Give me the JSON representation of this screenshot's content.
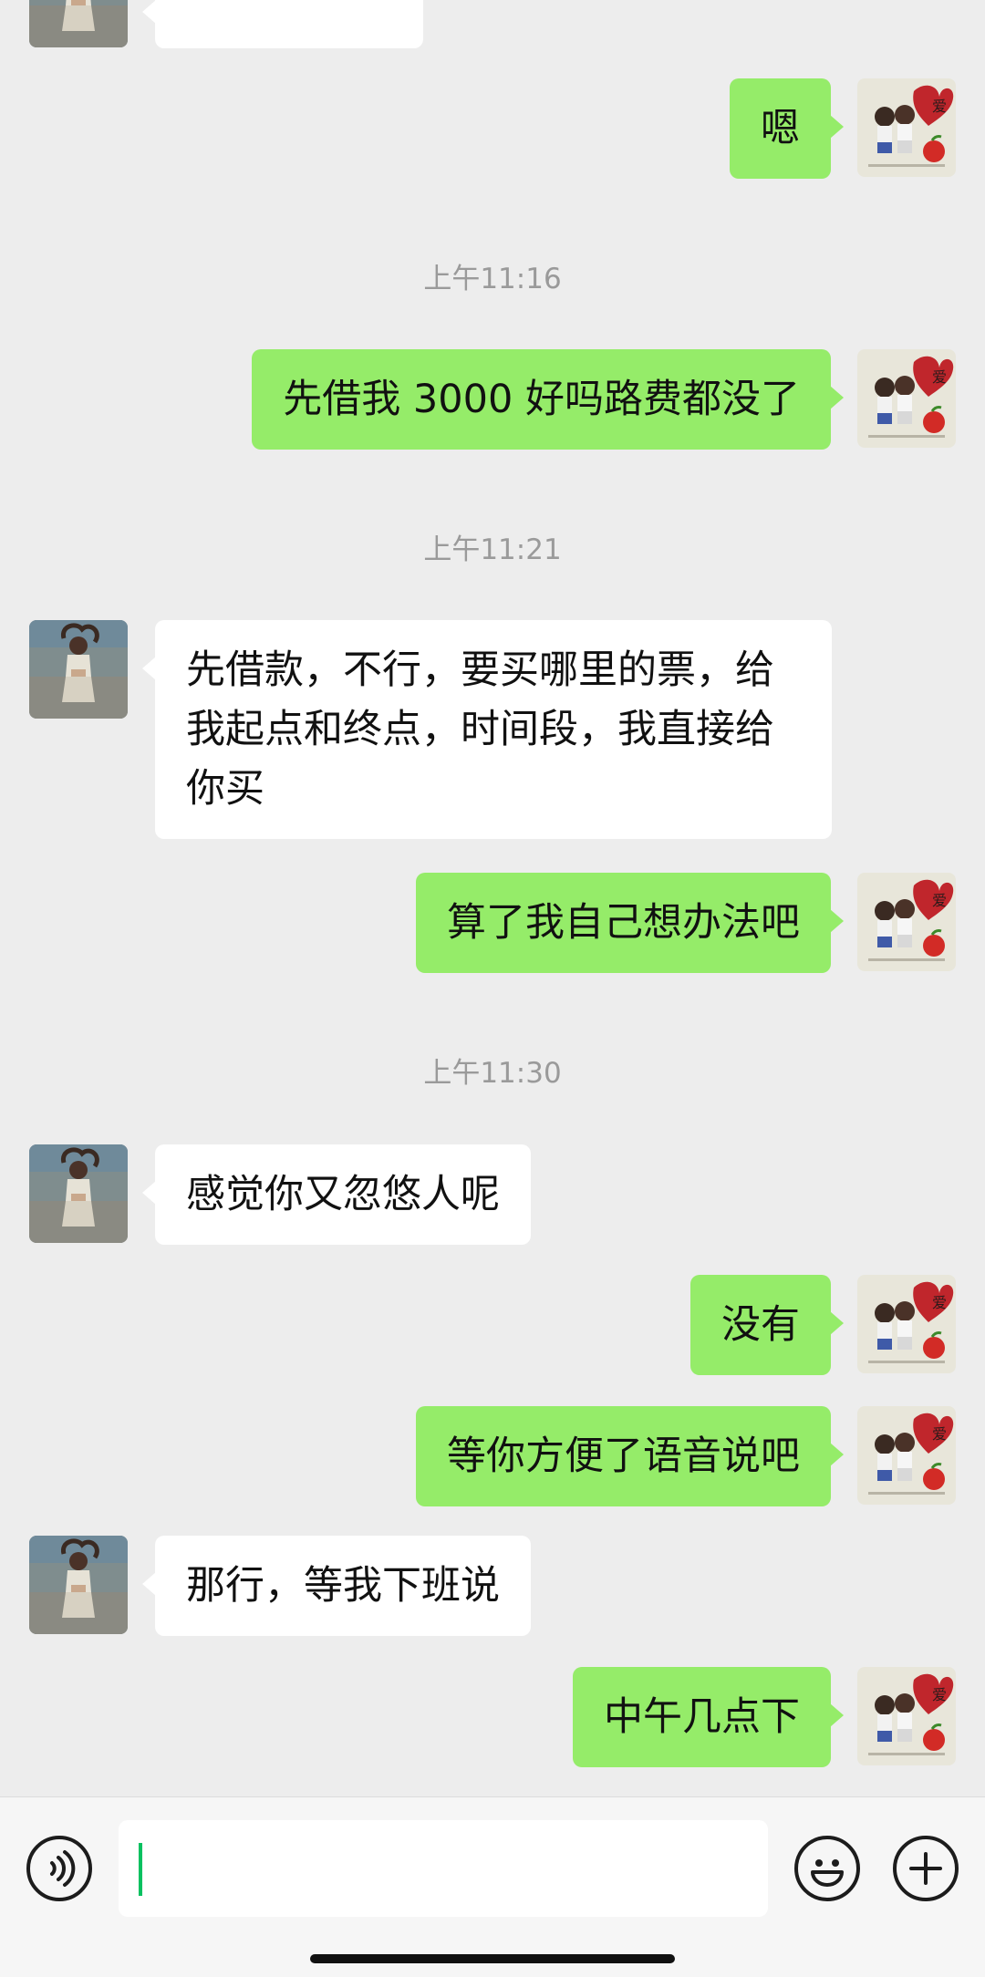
{
  "messages": [
    {
      "text": "嗯"
    },
    {
      "text": "先借我 3000 好吗路费都没了"
    },
    {
      "text": "先借款，不行，要买哪里的票，给我起点和终点，时间段，我直接给你买"
    },
    {
      "text": "算了我自己想办法吧"
    },
    {
      "text": "感觉你又忽悠人呢"
    },
    {
      "text": "没有"
    },
    {
      "text": "等你方便了语音说吧"
    },
    {
      "text": "那行，等我下班说"
    },
    {
      "text": "中午几点下"
    }
  ],
  "timestamps": [
    "上午11:16",
    "上午11:21",
    "上午11:30"
  ],
  "input": {
    "value": ""
  },
  "icons": {
    "voice": "voice-icon",
    "emoji": "emoji-icon",
    "more": "plus-icon"
  },
  "colors": {
    "my_bubble": "#95ec69",
    "their_bubble": "#ffffff",
    "background": "#ededed",
    "caret": "#07c160"
  }
}
